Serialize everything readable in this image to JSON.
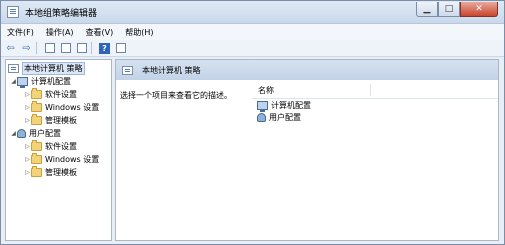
{
  "window": {
    "title": "本地组策略编辑器"
  },
  "menu": [
    "文件(F)",
    "操作(A)",
    "查看(V)",
    "帮助(H)"
  ],
  "tree": {
    "root": "本地计算机 策略",
    "computer_config": "计算机配置",
    "user_config": "用户配置",
    "computer_children": [
      "软件设置",
      "Windows 设置",
      "管理模板"
    ],
    "user_children": [
      "软件设置",
      "Windows 设置",
      "管理模板"
    ]
  },
  "content": {
    "header": "本地计算机 策略",
    "description": "选择一个项目来查看它的描述。",
    "list_header": "名称",
    "items": [
      "计算机配置",
      "用户配置"
    ]
  }
}
